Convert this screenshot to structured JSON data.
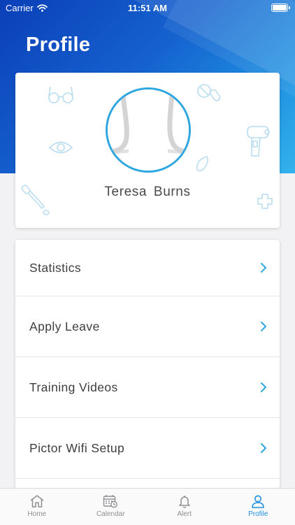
{
  "status_bar": {
    "carrier": "Carrier",
    "time": "11:51 AM"
  },
  "header": {
    "title": "Profile"
  },
  "profile": {
    "name": "Teresa  Burns"
  },
  "menu": {
    "items": [
      {
        "label": "Statistics",
        "icon": "chevron-right-icon"
      },
      {
        "label": "Apply Leave",
        "icon": "chevron-right-icon"
      },
      {
        "label": "Training Videos",
        "icon": "chevron-right-icon"
      },
      {
        "label": "Pictor Wifi Setup",
        "icon": "chevron-right-icon"
      }
    ]
  },
  "tab_bar": {
    "tabs": [
      {
        "label": "Home",
        "icon": "home-icon"
      },
      {
        "label": "Calendar",
        "icon": "calendar-icon"
      },
      {
        "label": "Alert",
        "icon": "bell-icon"
      },
      {
        "label": "Profile",
        "icon": "person-icon",
        "active": true
      }
    ]
  },
  "colors": {
    "accent": "#2ea6df",
    "header_gradient_start": "#0b3fb8",
    "header_gradient_end": "#33b3ec",
    "active_tab": "#1d8fdc",
    "inactive_tab": "#8e8e93"
  }
}
